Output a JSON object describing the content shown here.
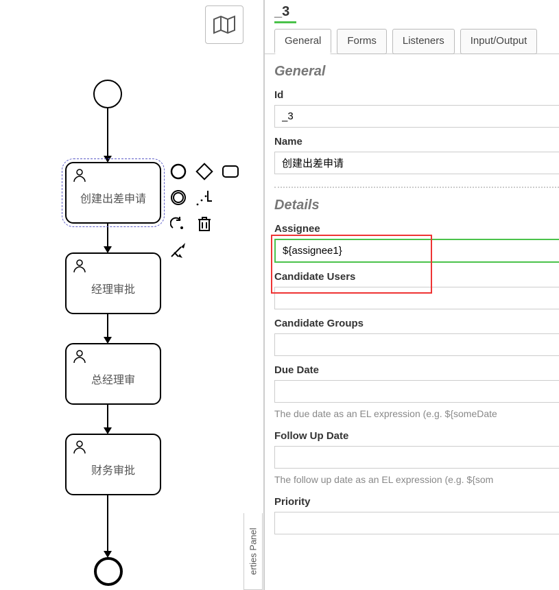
{
  "header": {
    "title": "_3"
  },
  "tabs": [
    {
      "label": "General",
      "active": true
    },
    {
      "label": "Forms",
      "active": false
    },
    {
      "label": "Listeners",
      "active": false
    },
    {
      "label": "Input/Output",
      "active": false
    }
  ],
  "sections": {
    "general": {
      "title": "General",
      "id_label": "Id",
      "id_value": "_3",
      "name_label": "Name",
      "name_value": "创建出差申请"
    },
    "details": {
      "title": "Details",
      "assignee_label": "Assignee",
      "assignee_value": "${assignee1}",
      "candidate_users_label": "Candidate Users",
      "candidate_users_value": "",
      "candidate_groups_label": "Candidate Groups",
      "candidate_groups_value": "",
      "due_date_label": "Due Date",
      "due_date_value": "",
      "due_date_help": "The due date as an EL expression (e.g. ${someDate",
      "follow_up_label": "Follow Up Date",
      "follow_up_value": "",
      "follow_up_help": "The follow up date as an EL expression (e.g. ${som",
      "priority_label": "Priority",
      "priority_value": ""
    }
  },
  "tasks": [
    {
      "label": "创建出差申请",
      "selected": true
    },
    {
      "label": "经理审批",
      "selected": false
    },
    {
      "label": "总经理审",
      "selected": false
    },
    {
      "label": "财务审批",
      "selected": false
    }
  ],
  "panel_tab_label": "erties Panel"
}
